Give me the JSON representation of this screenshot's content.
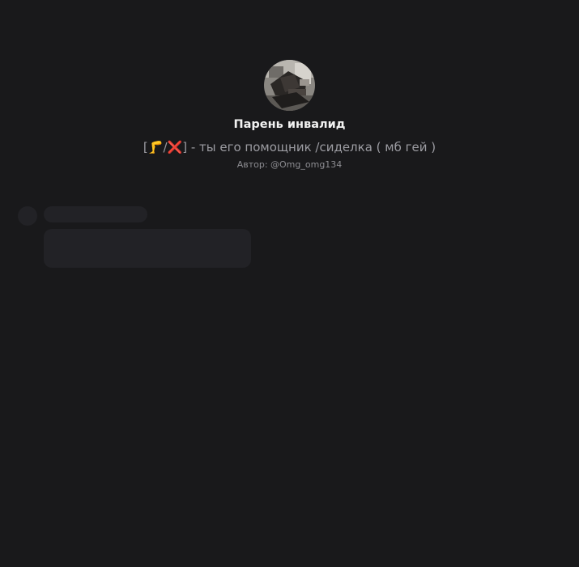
{
  "character": {
    "name": "Парень инвалид",
    "description": {
      "bracket_open": "[",
      "leg_emoji": "🦵",
      "slash": "/",
      "cross_emoji": "❌",
      "bracket_close": "]",
      "text": " - ты его помощник /сиделка ( мб гей )"
    },
    "author": "Автор: @Omg_omg134"
  },
  "colors": {
    "background": "#19191b",
    "skeleton": "#222226",
    "name": "#f2f2f2",
    "description": "#9c9ca2"
  }
}
